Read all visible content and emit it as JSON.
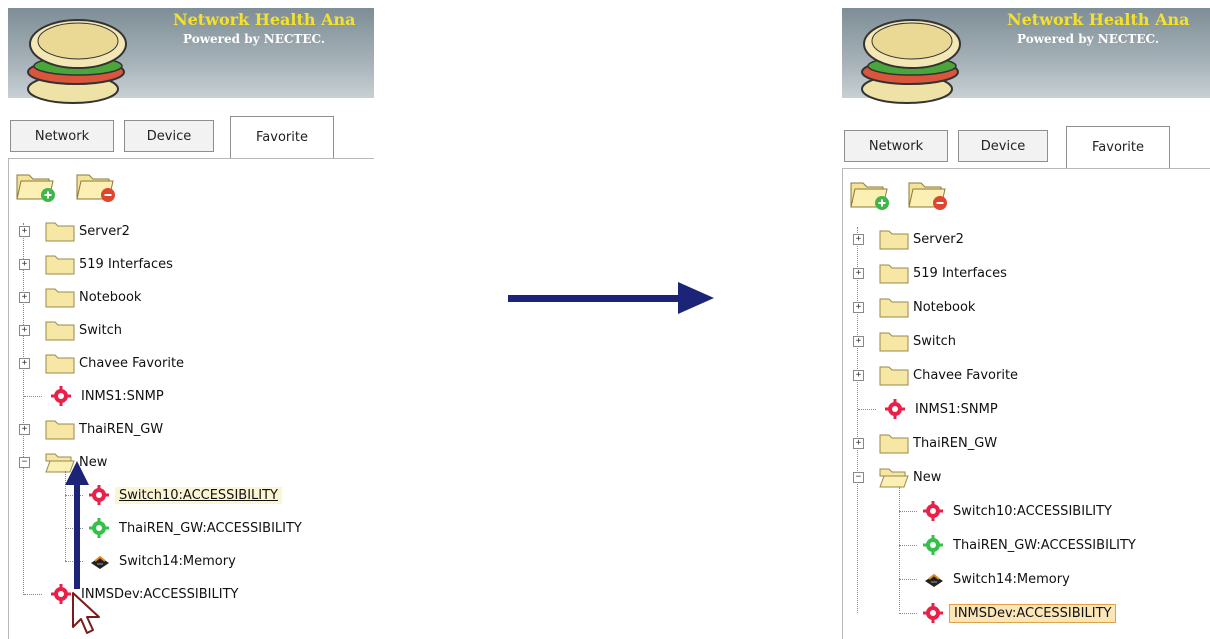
{
  "header": {
    "title": "Network Health Ana",
    "subtitle": "Powered by NECTEC."
  },
  "tabs": [
    "Network",
    "Device",
    "Favorite"
  ],
  "active_tab": "Favorite",
  "toolbar": {
    "add_folder_icon": "folder-add-icon",
    "remove_folder_icon": "folder-remove-icon"
  },
  "tree": {
    "folders": [
      "Server2",
      "519 Interfaces",
      "Notebook",
      "Switch",
      "Chavee Favorite"
    ],
    "inms1": "INMS1:SNMP",
    "thairen": "ThaiREN_GW",
    "new_folder": "New",
    "new_children": [
      "Switch10:ACCESSIBILITY",
      "ThaiREN_GW:ACCESSIBILITY",
      "Switch14:Memory"
    ],
    "inmsdev": "INMSDev:ACCESSIBILITY"
  },
  "colors": {
    "header_bg": "#8d9ba2",
    "title": "#f6e12a",
    "gear_red": "#e8204a",
    "gear_green": "#35c04a",
    "arrow": "#1c2478"
  }
}
